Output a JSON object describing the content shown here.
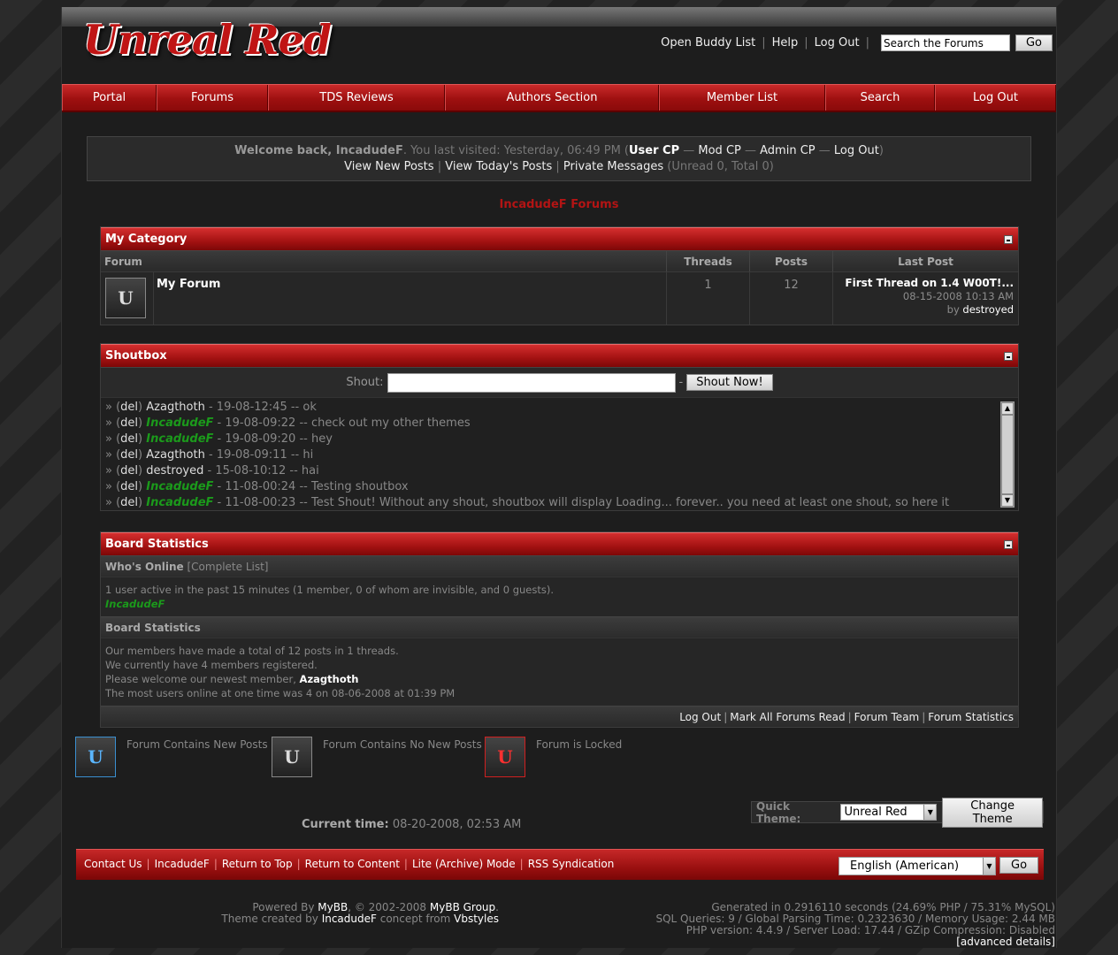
{
  "header": {
    "logo_text": "Unreal Red",
    "links": [
      "Open Buddy List",
      "Help",
      "Log Out"
    ],
    "search_value": "Search the Forums",
    "search_button": "Go"
  },
  "nav": [
    {
      "label": "Portal"
    },
    {
      "label": "Forums"
    },
    {
      "label": "TDS Reviews"
    },
    {
      "label": "Authors Section"
    },
    {
      "label": "Member List"
    },
    {
      "label": "Search"
    },
    {
      "label": "Log Out"
    }
  ],
  "welcome": {
    "prefix": "Welcome back, ",
    "username": "IncadudeF",
    "visited": ". You last visited: Yesterday, 06:49 PM (",
    "user_cp": "User CP",
    "dash1": " — ",
    "mod_cp": "Mod CP",
    "dash2": " — ",
    "admin_cp": "Admin CP",
    "dash3": " — ",
    "logout": "Log Out",
    "close": ")",
    "view_new": "View New Posts",
    "view_today": "View Today's Posts",
    "pm": "Private Messages",
    "pm_counts": " (Unread 0, Total 0)"
  },
  "board_title": "IncadudeF Forums",
  "category": {
    "title": "My Category",
    "headers": {
      "forum": "Forum",
      "threads": "Threads",
      "posts": "Posts",
      "last_post": "Last Post"
    },
    "forum": {
      "icon": "U",
      "name": "My Forum",
      "threads": "1",
      "posts": "12",
      "last_title": "First Thread on 1.4 W00T!...",
      "last_date": "08-15-2008 10:13 AM",
      "by": "by ",
      "last_user": "destroyed"
    }
  },
  "shoutbox": {
    "title": "Shoutbox",
    "label": "Shout:",
    "dash": "-",
    "button": "Shout Now!",
    "shouts": [
      {
        "user": "Azagthoth",
        "admin": false,
        "time": "19-08-12:45",
        "msg": "ok"
      },
      {
        "user": "IncadudeF",
        "admin": true,
        "time": "19-08-09:22",
        "msg": "check out my other themes"
      },
      {
        "user": "IncadudeF",
        "admin": true,
        "time": "19-08-09:20",
        "msg": "hey"
      },
      {
        "user": "Azagthoth",
        "admin": false,
        "time": "19-08-09:11",
        "msg": "hi"
      },
      {
        "user": "destroyed",
        "admin": false,
        "time": "15-08-10:12",
        "msg": "hai"
      },
      {
        "user": "IncadudeF",
        "admin": true,
        "time": "11-08-00:24",
        "msg": "Testing shoutbox"
      },
      {
        "user": "IncadudeF",
        "admin": true,
        "time": "11-08-00:23",
        "msg": "Test Shout! Without any shout, shoutbox will display Loading... forever.. you need at least one shout, so here it"
      }
    ]
  },
  "stats": {
    "title": "Board Statistics",
    "whos_online": "Who's Online",
    "complete_list": "[Complete List]",
    "online_text": "1 user active in the past 15 minutes (1 member, 0 of whom are invisible, and 0 guests).",
    "online_user": "IncadudeF",
    "board_stats": "Board Statistics",
    "line1": "Our members have made a total of 12 posts in 1 threads.",
    "line2": "We currently have 4 members registered.",
    "line3_prefix": "Please welcome our newest member, ",
    "newest": "Azagthoth",
    "line4": "The most users online at one time was 4 on 08-06-2008 at 01:39 PM",
    "footer_links": [
      "Log Out",
      "Mark All Forums Read",
      "Forum Team",
      "Forum Statistics"
    ]
  },
  "legend": [
    {
      "label": "Forum Contains New Posts",
      "icon": "U"
    },
    {
      "label": "Forum Contains No New Posts",
      "icon": "U"
    },
    {
      "label": "Forum is Locked",
      "icon": "U"
    }
  ],
  "quick_theme": {
    "label": "Quick Theme:",
    "value": "Unreal Red",
    "button": "Change Theme"
  },
  "current_time": {
    "label": "Current time:",
    "value": "08-20-2008, 02:53 AM"
  },
  "footer": {
    "links": [
      "Contact Us",
      "IncadudeF",
      "Return to Top",
      "Return to Content",
      "Lite (Archive) Mode",
      "RSS Syndication"
    ],
    "language": "English (American)",
    "go": "Go"
  },
  "credits": {
    "powered_prefix": "Powered By ",
    "mybb": "MyBB",
    "copyright": ", © 2002-2008 ",
    "mybb_group": "MyBB Group",
    "period": ".",
    "theme_prefix": "Theme created by ",
    "theme_author": "IncadudeF",
    "concept": " concept from ",
    "vbstyles": "Vbstyles",
    "gen1": "Generated in 0.2916110 seconds (24.69% PHP / 75.31% MySQL)",
    "gen2": "SQL Queries: 9 / Global Parsing Time: 0.2323630 / Memory Usage: 2.44 MB",
    "gen3": "PHP version: 4.4.9 / Server Load: 17.44 / GZip Compression: Disabled",
    "advanced": "[advanced details]"
  }
}
